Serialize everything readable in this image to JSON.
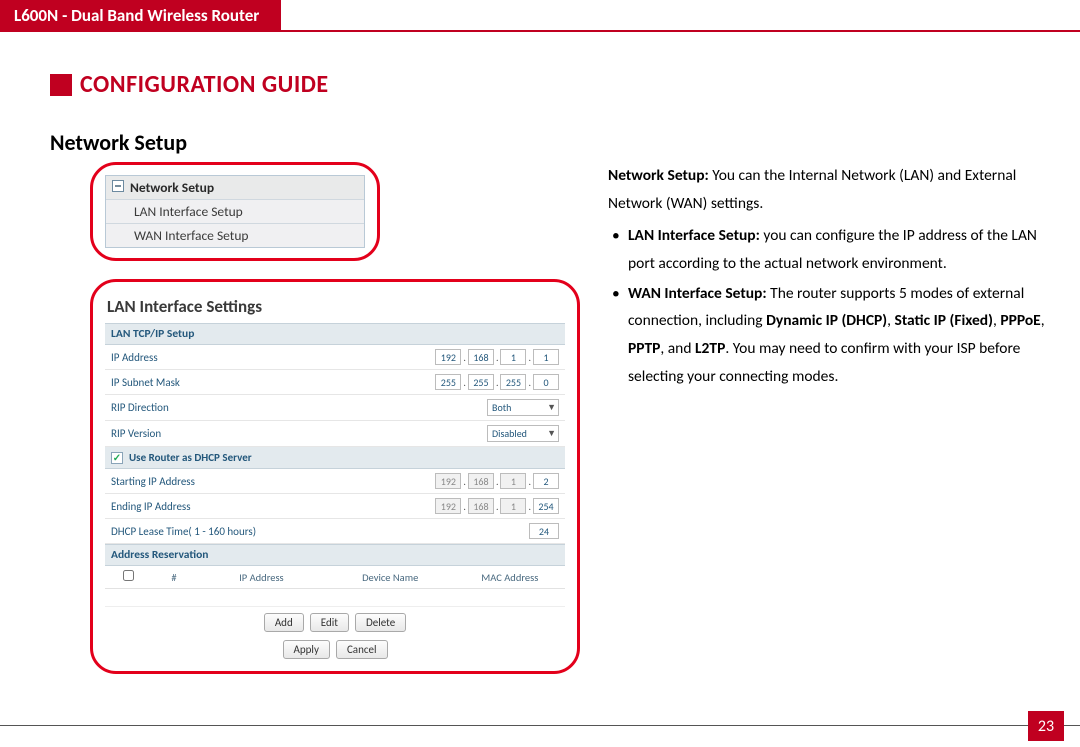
{
  "header": {
    "title": "L600N - Dual Band Wireless Router"
  },
  "chapter": {
    "title": "CONFIGURATION GUIDE"
  },
  "section": {
    "title": "Network Setup"
  },
  "nav": {
    "parent": "Network Setup",
    "children": [
      "LAN Interface Setup",
      "WAN Interface Setup"
    ]
  },
  "panel": {
    "title": "LAN Interface Settings",
    "sections": {
      "tcp": "LAN TCP/IP Setup",
      "dhcp_chk": "Use Router as DHCP Server",
      "reservation": "Address Reservation"
    },
    "rows": {
      "ip_label": "IP Address",
      "ip": [
        "192",
        "168",
        "1",
        "1"
      ],
      "mask_label": "IP Subnet Mask",
      "mask": [
        "255",
        "255",
        "255",
        "0"
      ],
      "rip_dir_label": "RIP Direction",
      "rip_dir": "Both",
      "rip_ver_label": "RIP Version",
      "rip_ver": "Disabled",
      "start_label": "Starting IP Address",
      "start": [
        "192",
        "168",
        "1",
        "2"
      ],
      "end_label": "Ending IP Address",
      "end": [
        "192",
        "168",
        "1",
        "254"
      ],
      "lease_label": "DHCP Lease Time( 1 - 160 hours)",
      "lease": "24"
    },
    "table_headers": [
      "#",
      "IP Address",
      "Device Name",
      "MAC Address"
    ],
    "buttons": {
      "add": "Add",
      "edit": "Edit",
      "delete": "Delete",
      "apply": "Apply",
      "cancel": "Cancel"
    }
  },
  "desc": {
    "intro_bold": "Network Setup:",
    "intro_rest": " You can the Internal Network (LAN) and External Network (WAN) settings.",
    "lan_bold": "LAN Interface Setup:",
    "lan_rest": " you can configure the IP address of the LAN port according to the actual network environment.",
    "wan_bold": "WAN Interface  Setup:",
    "wan_mid1": " The router supports 5 modes of external connection, including ",
    "wan_b1": "Dynamic IP (DHCP)",
    "wan_c1": ", ",
    "wan_b2": "Static IP (Fixed)",
    "wan_c2": ", ",
    "wan_b3": "PPPoE",
    "wan_c3": ", ",
    "wan_b4": "PPTP",
    "wan_c4": ", and ",
    "wan_b5": "L2TP",
    "wan_tail": ". You may need to confirm with your ISP before selecting your connecting modes."
  },
  "page_number": "23"
}
